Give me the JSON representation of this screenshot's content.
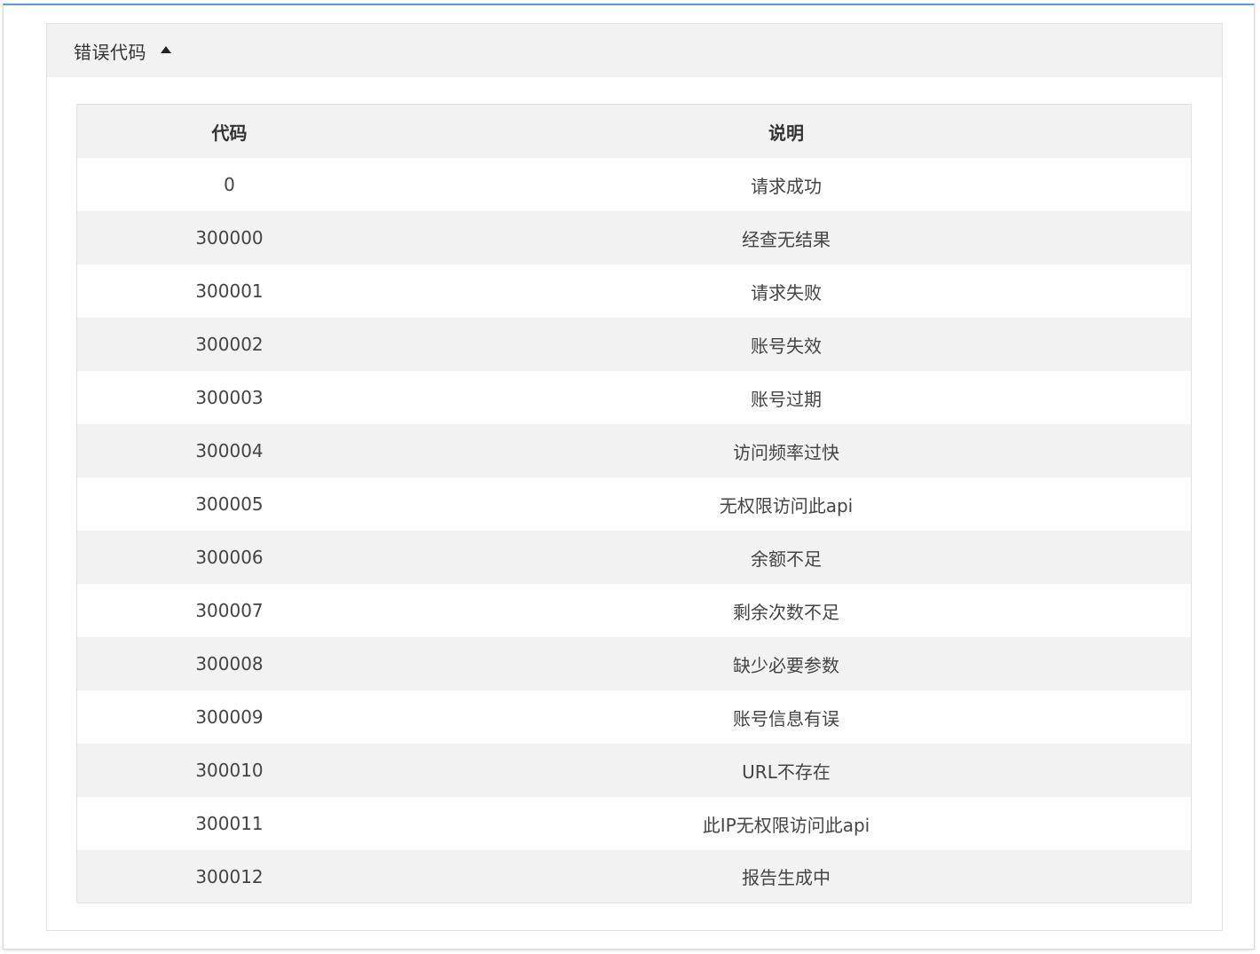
{
  "panel": {
    "title": "错误代码"
  },
  "table": {
    "headers": [
      "代码",
      "说明"
    ],
    "rows": [
      {
        "code": "0",
        "desc": "请求成功"
      },
      {
        "code": "300000",
        "desc": "经查无结果"
      },
      {
        "code": "300001",
        "desc": "请求失败"
      },
      {
        "code": "300002",
        "desc": "账号失效"
      },
      {
        "code": "300003",
        "desc": "账号过期"
      },
      {
        "code": "300004",
        "desc": "访问频率过快"
      },
      {
        "code": "300005",
        "desc": "无权限访问此api"
      },
      {
        "code": "300006",
        "desc": "余额不足"
      },
      {
        "code": "300007",
        "desc": "剩余次数不足"
      },
      {
        "code": "300008",
        "desc": "缺少必要参数"
      },
      {
        "code": "300009",
        "desc": "账号信息有误"
      },
      {
        "code": "300010",
        "desc": "URL不存在"
      },
      {
        "code": "300011",
        "desc": "此IP无权限访问此api"
      },
      {
        "code": "300012",
        "desc": "报告生成中"
      }
    ]
  },
  "icons": {
    "collapse_toggle": "caret-up-icon"
  },
  "colors": {
    "header_bg": "#f2f2f2",
    "row_stripe": "#f2f2f2",
    "frame_accent": "#5b9bd5"
  }
}
